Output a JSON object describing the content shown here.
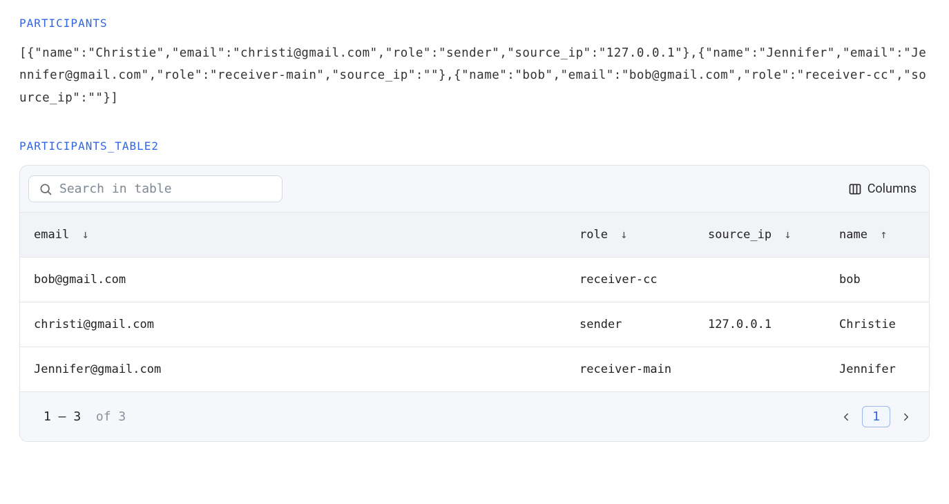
{
  "section1": {
    "label": "PARTICIPANTS",
    "json_text": "[{\"name\":\"Christie\",\"email\":\"christi@gmail.com\",\"role\":\"sender\",\"source_ip\":\"127.0.0.1\"},{\"name\":\"Jennifer\",\"email\":\"Jennifer@gmail.com\",\"role\":\"receiver-main\",\"source_ip\":\"\"},{\"name\":\"bob\",\"email\":\"bob@gmail.com\",\"role\":\"receiver-cc\",\"source_ip\":\"\"}]"
  },
  "section2": {
    "label": "PARTICIPANTS_TABLE2",
    "search_placeholder": "Search in table",
    "columns_label": "Columns",
    "headers": {
      "email": "email",
      "role": "role",
      "source_ip": "source_ip",
      "name": "name"
    },
    "rows": [
      {
        "email": "bob@gmail.com",
        "role": "receiver-cc",
        "source_ip": "",
        "name": "bob"
      },
      {
        "email": "christi@gmail.com",
        "role": "sender",
        "source_ip": "127.0.0.1",
        "name": "Christie"
      },
      {
        "email": "Jennifer@gmail.com",
        "role": "receiver-main",
        "source_ip": "",
        "name": "Jennifer"
      }
    ],
    "pagination": {
      "range": "1 – 3",
      "of_label": "of",
      "total": "3",
      "current_page": "1"
    }
  }
}
